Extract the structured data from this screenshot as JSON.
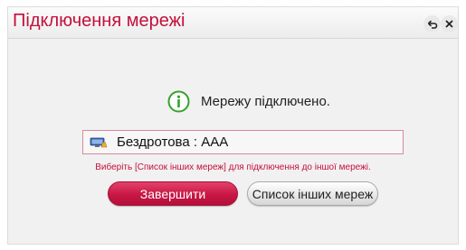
{
  "dialog": {
    "title": "Підключення мережі"
  },
  "header_icons": {
    "back": "back-icon",
    "close": "close-icon"
  },
  "status": {
    "icon": "info-icon",
    "message": "Мережу підключено."
  },
  "network": {
    "icon": "network-icon",
    "label": "Бездротова : AAA"
  },
  "hint": {
    "text": "Виберіть [Список інших мереж] для підключення до іншої мережі."
  },
  "buttons": {
    "finish": "Завершити",
    "other_networks": "Список інших мереж"
  },
  "colors": {
    "accent": "#c4103c",
    "info": "#37a22a",
    "background": "#f1f1f1"
  }
}
